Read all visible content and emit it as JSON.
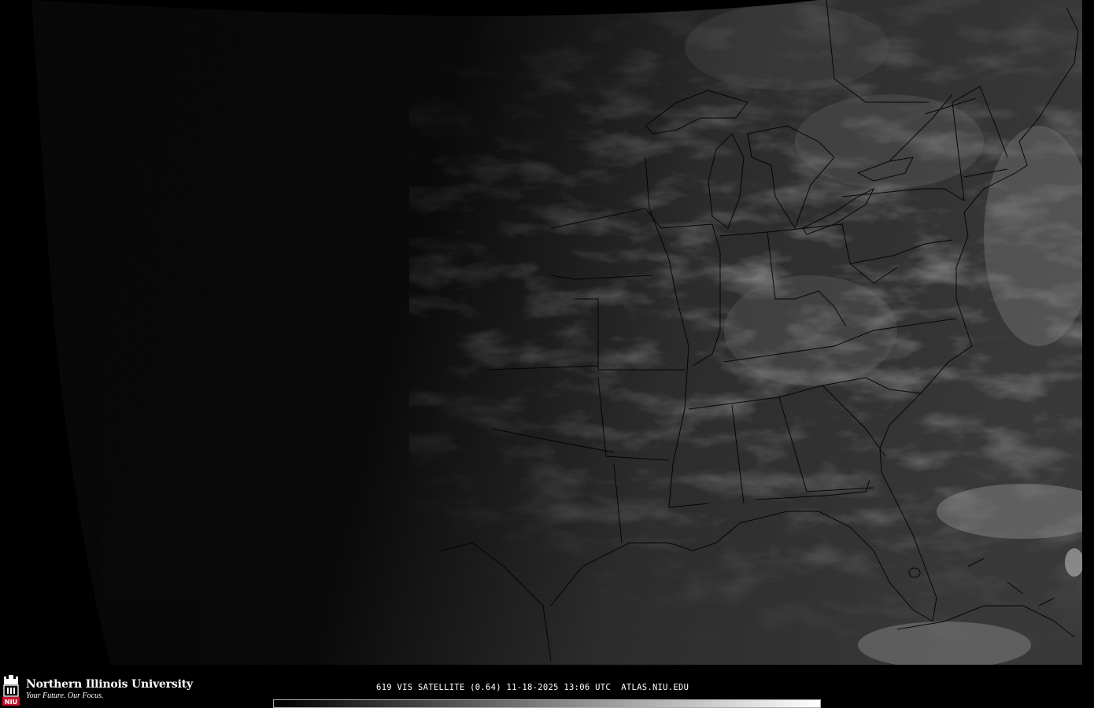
{
  "map": {
    "product": "GOES visible satellite imagery",
    "region": "Eastern United States",
    "imagery_tone": "grayscale",
    "features": [
      "state-boundaries",
      "coastlines",
      "great-lakes",
      "cloud-cover"
    ]
  },
  "footer": {
    "university_name": "Northern Illinois University",
    "tagline": "Your Future. Our Focus.",
    "logo_letters": "NIU",
    "caption": "619 VIS SATELLITE (0.64) 11-18-2025 13:06 UTC  ATLAS.NIU.EDU",
    "colorbar_colors": [
      "#000000",
      "#ffffff"
    ]
  },
  "colors": {
    "background": "#000000",
    "boundary_line": "#000000",
    "logo_red": "#c8102e",
    "text": "#ffffff"
  }
}
